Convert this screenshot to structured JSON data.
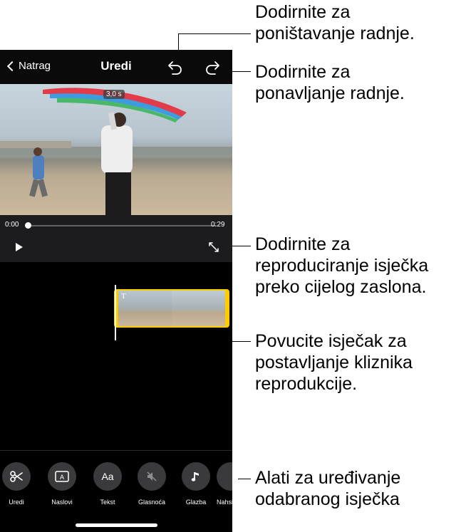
{
  "nav": {
    "back_label": "Natrag",
    "title": "Uredi"
  },
  "video": {
    "duration_badge": "3,0 s"
  },
  "player": {
    "time_start": "0:00",
    "time_end": "0:29",
    "progress": 0.0
  },
  "tools": [
    {
      "label": "Uredi",
      "icon": "scissors-icon"
    },
    {
      "label": "Naslovi",
      "icon": "titles-icon"
    },
    {
      "label": "Tekst",
      "icon": "text-icon",
      "glyph": "Aa"
    },
    {
      "label": "Glasnoća",
      "icon": "muted-speaker-icon"
    },
    {
      "label": "Glazba",
      "icon": "music-note-icon"
    },
    {
      "label": "Nahsi",
      "icon": "more-icon"
    }
  ],
  "callouts": {
    "undo": [
      "Dodirnite za",
      "poništavanje radnje."
    ],
    "redo": [
      "Dodirnite za",
      "ponavljanje radnje."
    ],
    "fullscreen": [
      "Dodirnite za",
      "reproduciranje isječka",
      "preko cijelog zaslona."
    ],
    "drag": [
      "Povucite isječak za",
      "postavljanje kliznika",
      "reprodukcije."
    ],
    "tools": [
      "Alati za uređivanje",
      "odabranog isječka"
    ]
  }
}
